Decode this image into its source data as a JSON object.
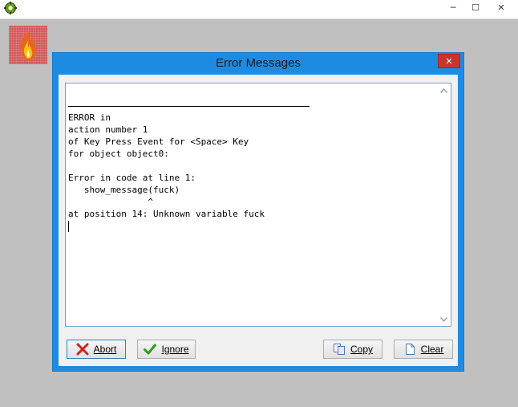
{
  "app": {
    "minimize_glyph": "─",
    "maximize_glyph": "☐",
    "close_glyph": "✕"
  },
  "dialog": {
    "title": "Error Messages",
    "close_glyph": "✕",
    "message_lines": [
      "",
      "ERROR in",
      "action number 1",
      "of Key Press Event for <Space> Key",
      "for object object0:",
      "",
      "Error in code at line 1:",
      "   show_message(fuck)",
      "               ^",
      "at position 14: Unknown variable fuck"
    ],
    "buttons": {
      "abort": "Abort",
      "ignore": "Ignore",
      "copy": "Copy",
      "clear": "Clear"
    }
  },
  "icons": {
    "app": "gear-icon",
    "sprite": "fire-icon",
    "abort": "red-x-icon",
    "ignore": "green-check-icon",
    "copy": "copy-icon",
    "clear": "blank-page-icon"
  },
  "colors": {
    "dialog_frame": "#1e8be3",
    "close_button": "#c7352d",
    "background": "#c0c0c0"
  }
}
